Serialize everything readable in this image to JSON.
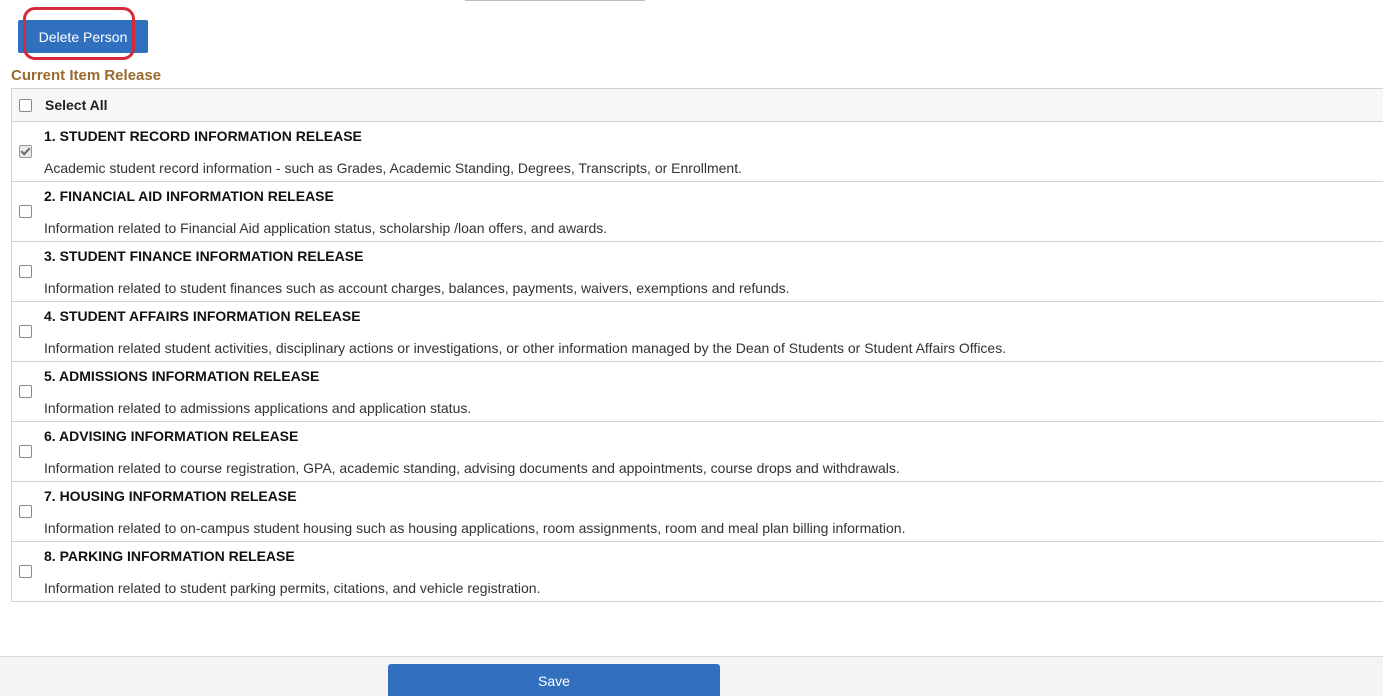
{
  "toolbar": {
    "delete_label": "Delete Person"
  },
  "section": {
    "title": "Current Item Release"
  },
  "select_all": {
    "label": "Select All",
    "checked": false
  },
  "items": [
    {
      "title": "1. STUDENT RECORD INFORMATION RELEASE",
      "description": "Academic student record information - such as Grades, Academic Standing, Degrees, Transcripts,  or Enrollment.",
      "checked": true
    },
    {
      "title": "2. FINANCIAL AID INFORMATION RELEASE",
      "description": "Information related to Financial Aid application status, scholarship /loan offers, and awards.",
      "checked": false
    },
    {
      "title": "3. STUDENT FINANCE INFORMATION RELEASE",
      "description": "Information related to student finances such as account charges, balances,  payments, waivers, exemptions and refunds.",
      "checked": false
    },
    {
      "title": "4. STUDENT AFFAIRS INFORMATION RELEASE",
      "description": "Information related student activities, disciplinary actions or investigations, or other information managed by the Dean of Students or Student Affairs Offices.",
      "checked": false
    },
    {
      "title": "5. ADMISSIONS INFORMATION RELEASE",
      "description": "Information related to admissions applications and application status.",
      "checked": false
    },
    {
      "title": "6. ADVISING INFORMATION RELEASE",
      "description": "Information related to course registration, GPA, academic standing, advising documents and appointments, course drops and withdrawals.",
      "checked": false
    },
    {
      "title": "7. HOUSING INFORMATION RELEASE",
      "description": "Information related to on-campus student housing such as housing applications, room assignments, room and meal plan billing information.",
      "checked": false
    },
    {
      "title": "8. PARKING INFORMATION RELEASE",
      "description": "Information related to student parking permits, citations, and vehicle registration.",
      "checked": false
    }
  ],
  "footer": {
    "save_label": "Save"
  },
  "colors": {
    "primary_button": "#3170bf",
    "section_title": "#9a6a2f",
    "highlight": "#d42a3a"
  }
}
